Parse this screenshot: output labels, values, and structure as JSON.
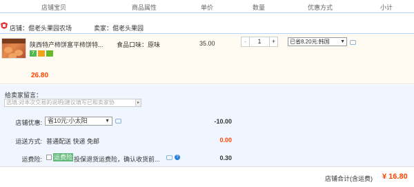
{
  "header": {
    "columns": [
      "店铺宝贝",
      "商品属性",
      "单价",
      "数量",
      "优惠方式",
      "小计"
    ]
  },
  "shop": {
    "name": "店铺：倔老头果园农场",
    "seller": "卖家：倔老头果园"
  },
  "item": {
    "title": "陕西特产柿饼富平柿饼特...",
    "sku": "食品口味：原味",
    "price": "35.00",
    "quantity": "1",
    "qty_minus": "-",
    "qty_plus": "+",
    "discount": "已省8.20元:韩国",
    "subtotal": "26.80",
    "badges": [
      "7",
      "",
      ""
    ]
  },
  "options": {
    "leave_message_label": "给卖家留言：",
    "leave_message_placeholder": "选填:对本次交易的说明(建议填写已和卖家协",
    "store_coupon_label": "店铺优惠:",
    "store_coupon_value": "省10元:小太阳",
    "store_coupon_amount": "-10.00",
    "shipping_label": "运送方式:",
    "shipping_value": "普通配送 快递 免邮",
    "shipping_amount": "0.00",
    "insurance_label": "运费险:",
    "insurance_tag": "运费险",
    "insurance_text": "投保退货运费险，确认收货前...",
    "insurance_amount": "0.30"
  },
  "footer": {
    "total_label": "店铺合计(含运费)",
    "total_amount": "¥ 16.80"
  },
  "colors": {
    "accent": "#ff4400",
    "header_border": "#b2d1ff",
    "options_bg": "#f0f6ff",
    "item_bg": "#fffbf3"
  }
}
